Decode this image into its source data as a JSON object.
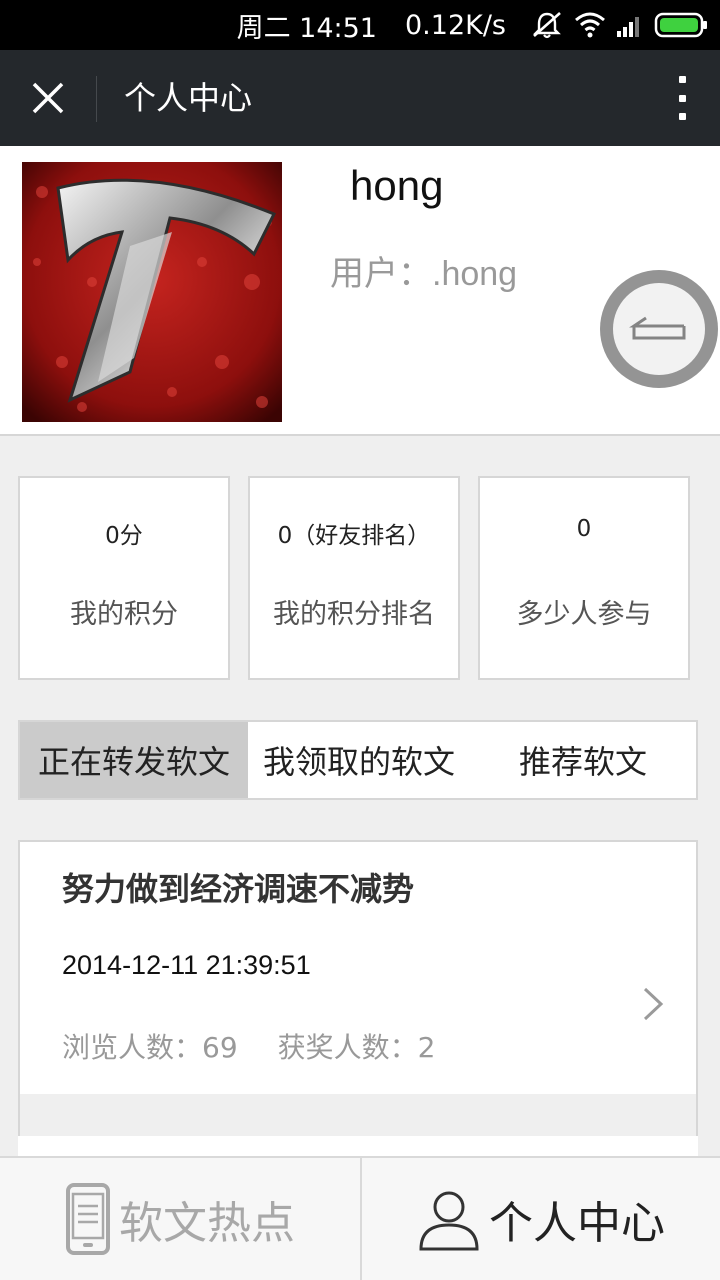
{
  "status_bar": {
    "time": "周二 14:51",
    "net_speed": "0.12K/s",
    "icons": [
      "mute-icon",
      "wifi-icon",
      "signal-icon",
      "battery-icon"
    ]
  },
  "header": {
    "title": "个人中心",
    "close_icon": "close-icon",
    "more_icon": "more-vertical-icon"
  },
  "profile": {
    "name": "hong",
    "user_line": "用户：.hong",
    "float_button_icon": "return-icon"
  },
  "stats": [
    {
      "value": "0分",
      "label": "我的积分"
    },
    {
      "value": "0（好友排名）",
      "label": "我的积分排名"
    },
    {
      "value": "0",
      "label": "多少人参与"
    }
  ],
  "tabs": [
    {
      "label": "正在转发软文",
      "active": true
    },
    {
      "label": "我领取的软文",
      "active": false
    },
    {
      "label": "推荐软文",
      "active": false
    }
  ],
  "articles": [
    {
      "title": "努力做到经济调速不减势",
      "date": "2014-12-11 21:39:51",
      "views": "浏览人数：69",
      "winners": "获奖人数：2"
    }
  ],
  "bottom_nav": [
    {
      "label": "软文热点",
      "icon": "phone-icon",
      "active": false
    },
    {
      "label": "个人中心",
      "icon": "user-icon",
      "active": true
    }
  ],
  "colors": {
    "title_bar": "#24282c",
    "active_tab": "#cbcbcb",
    "muted_text": "#999999"
  }
}
